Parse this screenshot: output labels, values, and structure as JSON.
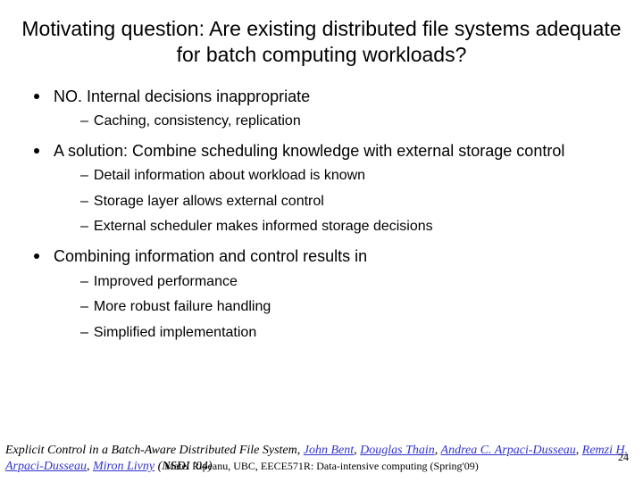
{
  "title": "Motivating question: Are existing distributed file systems adequate for batch computing workloads?",
  "bullets": [
    {
      "text": "NO.  Internal decisions inappropriate",
      "sub": [
        "Caching, consistency, replication"
      ]
    },
    {
      "text": "A solution: Combine scheduling knowledge with external storage control",
      "sub": [
        "Detail information about workload is known",
        "Storage layer allows external control",
        "External scheduler makes informed storage decisions"
      ]
    },
    {
      "text": "Combining information and control results in",
      "sub": [
        "Improved performance",
        "More robust failure handling",
        "Simplified implementation"
      ]
    }
  ],
  "citation": {
    "prefix": "Explicit Control in a Batch-Aware Distributed File System",
    "authors": [
      "John Bent",
      "Douglas Thain",
      "Andrea C. Arpaci-Dusseau",
      "Remzi H. Arpaci-Dusseau",
      "Miron Livny"
    ],
    "suffix": " (NSDI '04)"
  },
  "footer": "Matei Ripeanu, UBC,  EECE571R: Data-intensive computing (Spring'09)",
  "page": "24"
}
